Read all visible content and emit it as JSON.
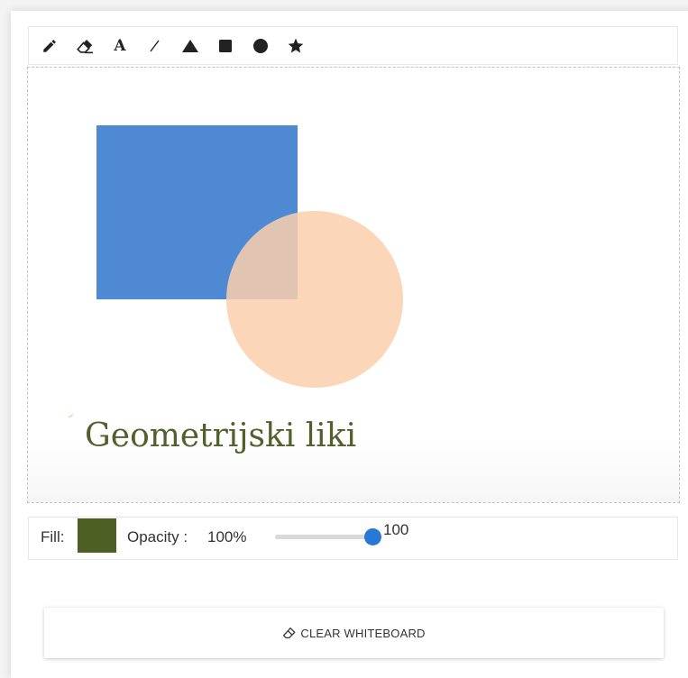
{
  "toolbar": {
    "tools": [
      {
        "name": "pencil-icon"
      },
      {
        "name": "eraser-icon"
      },
      {
        "name": "text-icon",
        "glyph": "A"
      },
      {
        "name": "line-icon"
      },
      {
        "name": "triangle-icon"
      },
      {
        "name": "rectangle-icon"
      },
      {
        "name": "circle-icon"
      },
      {
        "name": "star-icon"
      }
    ],
    "icon_color": "#222222"
  },
  "canvas": {
    "shapes": [
      {
        "type": "rectangle",
        "color": "#5089d3"
      },
      {
        "type": "circle",
        "color": "#fbcfab",
        "opacity": 0.85
      }
    ],
    "text": {
      "value": "Geometrijski liki",
      "color": "#52612c"
    }
  },
  "properties": {
    "fill_label": "Fill:",
    "fill_color": "#4d5f23",
    "opacity_label": "Opacity :",
    "opacity_display": "100%",
    "slider_value": "100",
    "slider_level": 1.0,
    "slider_color": "#2878d6"
  },
  "clear_button": {
    "icon": "eraser-icon",
    "label": "CLEAR WHITEBOARD"
  }
}
